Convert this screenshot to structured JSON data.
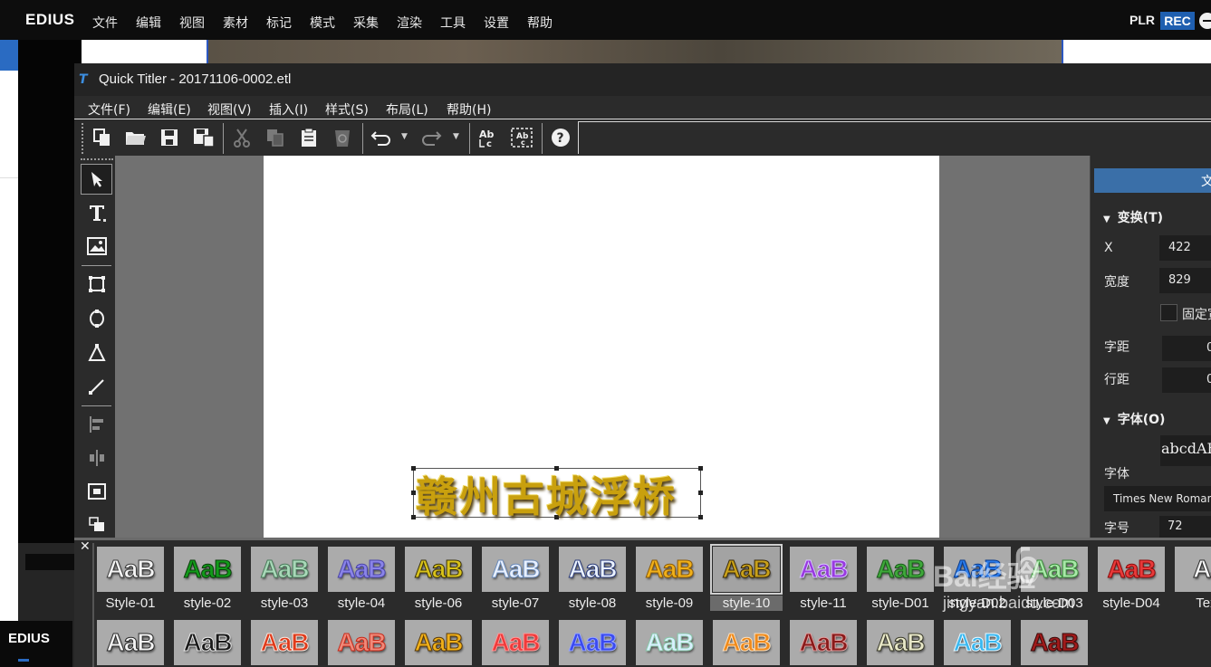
{
  "edius": {
    "logo": "EDIUS",
    "menu": [
      "文件",
      "编辑",
      "视图",
      "素材",
      "标记",
      "模式",
      "采集",
      "渲染",
      "工具",
      "设置",
      "帮助"
    ],
    "plr": "PLR",
    "rec": "REC",
    "bottom_logo": "EDIUS"
  },
  "titler": {
    "window_title": "Quick Titler - 20171106-0002.etl",
    "title_icon": "T",
    "menu": [
      "文件(F)",
      "编辑(E)",
      "视图(V)",
      "插入(I)",
      "样式(S)",
      "布局(L)",
      "帮助(H)"
    ],
    "canvas_text": "赣州古城浮桥"
  },
  "properties": {
    "tab_label": "文",
    "transform_section": "变换(T)",
    "x_label": "X",
    "x_value": "422",
    "width_label": "宽度",
    "width_value": "829",
    "fixed_label": "固定宽",
    "char_spacing_label": "字距",
    "char_spacing_value": "0",
    "line_spacing_label": "行距",
    "line_spacing_value": "0",
    "font_section": "字体(O)",
    "font_preview": "abcdABC",
    "font_label": "字体",
    "font_name": "Times New Roman",
    "size_label": "字号",
    "size_value": "72"
  },
  "gallery": {
    "row1": [
      {
        "label": "Style-01",
        "text": "AaB",
        "color": "#f4f4f4",
        "stroke": "#3a3a3a"
      },
      {
        "label": "style-02",
        "text": "AaB",
        "color": "#129a1a",
        "stroke": "#0a3d0a"
      },
      {
        "label": "style-03",
        "text": "AaB",
        "color": "#a8d8b8",
        "stroke": "#4a7a5a"
      },
      {
        "label": "style-04",
        "text": "AaB",
        "color": "#8a84e8",
        "stroke": "#4a44a8"
      },
      {
        "label": "style-06",
        "text": "AaB",
        "color": "#d8c21a",
        "stroke": "#3a3208"
      },
      {
        "label": "style-07",
        "text": "AaB",
        "color": "#e8f0ff",
        "stroke": "#6a8ab8"
      },
      {
        "label": "style-08",
        "text": "AaB",
        "color": "#eaf2ff",
        "stroke": "#2a3a78"
      },
      {
        "label": "style-09",
        "text": "AaB",
        "color": "#f0b01a",
        "stroke": "#8a5a08"
      },
      {
        "label": "style-10",
        "text": "AaB",
        "color": "#c8a01a",
        "stroke": "#3a2a08"
      },
      {
        "label": "style-11",
        "text": "AaB",
        "color": "#9a3ae0",
        "stroke": "#d8c8ff"
      },
      {
        "label": "style-D01",
        "text": "AaB",
        "color": "#3ea83a",
        "stroke": "#1a5a1a"
      },
      {
        "label": "style-D02",
        "text": "AaB",
        "color": "#2a7ae8",
        "stroke": "#0a3a8a"
      },
      {
        "label": "style-D03",
        "text": "AaB",
        "color": "#a8e8a8",
        "stroke": "#3a8a3a"
      },
      {
        "label": "style-D04",
        "text": "AaB",
        "color": "#e83a3a",
        "stroke": "#8a0a0a"
      },
      {
        "label": "Text",
        "text": "Aa",
        "color": "#f4f4f4",
        "stroke": "#2a2a2a"
      }
    ],
    "row2": [
      {
        "text": "AaB",
        "color": "#f4f4f4",
        "stroke": "#2a2a2a"
      },
      {
        "text": "AaB",
        "color": "#1a1a1a",
        "stroke": "#e8e8e8"
      },
      {
        "text": "AaB",
        "color": "#e03a1a",
        "stroke": "#fae8e0"
      },
      {
        "text": "AaB",
        "color": "#f08a7a",
        "stroke": "#c82a1a"
      },
      {
        "text": "AaB",
        "color": "#f0b01a",
        "stroke": "#5a3a08"
      },
      {
        "text": "AaB",
        "color": "#f03a3a",
        "stroke": "#ff9a9a"
      },
      {
        "text": "AaB",
        "color": "#3a4af0",
        "stroke": "#9aa8ff"
      },
      {
        "text": "AaB",
        "color": "#d8f0ff",
        "stroke": "#8ac8a8"
      },
      {
        "text": "AaB",
        "color": "#f08a1a",
        "stroke": "#fae0c0"
      },
      {
        "text": "AaB",
        "color": "#8a1a1a",
        "stroke": "#e0a0a0"
      },
      {
        "text": "AaB",
        "color": "#e8e8c8",
        "stroke": "#3a3a2a"
      },
      {
        "text": "AaB",
        "color": "#3ab8f0",
        "stroke": "#e8f8ff"
      },
      {
        "text": "AaB",
        "color": "#a01a1a",
        "stroke": "#3a0a0a"
      }
    ]
  },
  "watermark": {
    "icon": "ɓ",
    "brand": "Bai经验",
    "site": "jingyan.baidu.com"
  },
  "colors": {
    "accent": "#3a6fa8",
    "rec": "#1f5fb0",
    "title_gold": "#c9a00e"
  }
}
